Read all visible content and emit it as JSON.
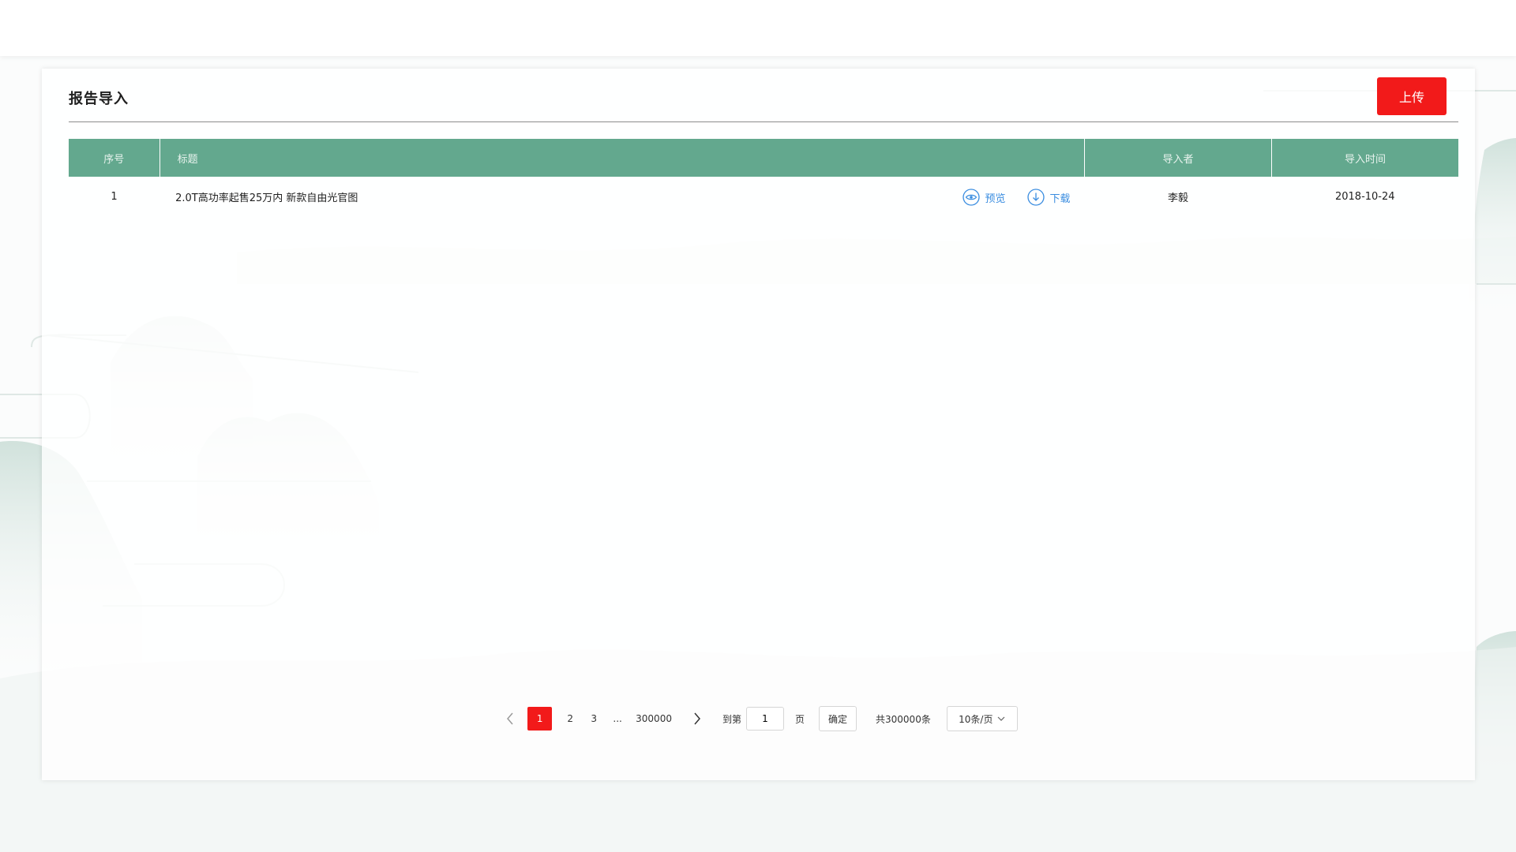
{
  "card": {
    "title": "报告导入",
    "upload_label": "上传"
  },
  "table": {
    "columns": [
      "序号",
      "标题",
      "导入者",
      "导入时间"
    ],
    "rows": [
      {
        "index": "1",
        "title": "2.0T高功率起售25万内 新款自由光官图",
        "preview_label": "预览",
        "download_label": "下载",
        "importer": "李毅",
        "time": "2018-10-24"
      }
    ]
  },
  "pagination": {
    "pages": [
      "1",
      "2",
      "3",
      "...",
      "300000"
    ],
    "active_page": "1",
    "goto_prefix": "到第",
    "goto_value": "1",
    "goto_suffix": "页",
    "confirm_label": "确定",
    "total_text": "共300000条",
    "page_size": "10条/页"
  },
  "colors": {
    "accent": "#f21a1a",
    "header_bg": "#63a88e",
    "link": "#3a8de0"
  },
  "icons": {
    "preview": "eye-icon",
    "download": "download-icon",
    "prev": "chevron-left-icon",
    "next": "chevron-right-icon",
    "dropdown": "chevron-down-icon"
  }
}
